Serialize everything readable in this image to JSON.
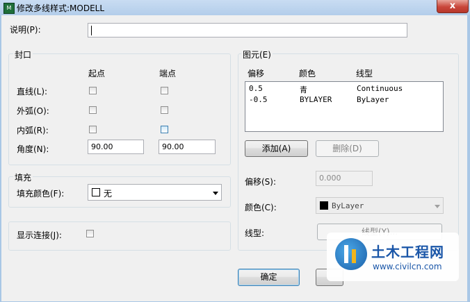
{
  "window": {
    "title": "修改多线样式:MODELL",
    "app_icon": "M",
    "close_glyph": "x"
  },
  "description": {
    "label": "说明(P):",
    "value": ""
  },
  "caps": {
    "group_title": "封口",
    "col_start": "起点",
    "col_end": "端点",
    "rows": [
      {
        "label": "直线(L):"
      },
      {
        "label": "外弧(O):"
      },
      {
        "label": "内弧(R):"
      }
    ],
    "angle_label": "角度(N):",
    "angle_start": "90.00",
    "angle_end": "90.00"
  },
  "fill": {
    "group_title": "填充",
    "color_label": "填充颜色(F):",
    "color_value": "无"
  },
  "joints": {
    "label": "显示连接(J):"
  },
  "elements": {
    "group_title": "图元(E)",
    "columns": [
      "偏移",
      "颜色",
      "线型"
    ],
    "rows": [
      {
        "offset": "0.5",
        "color": "青",
        "linetype": "Continuous"
      },
      {
        "offset": "-0.5",
        "color": "BYLAYER",
        "linetype": "ByLayer"
      }
    ],
    "add_button": "添加(A)",
    "delete_button": "删除(D)",
    "offset_label": "偏移(S):",
    "offset_value": "0.000",
    "color_label": "颜色(C):",
    "color_value": "ByLayer",
    "linetype_label": "线型:",
    "linetype_button": "线型(Y)..."
  },
  "footer": {
    "ok_button": "确定"
  },
  "watermark": {
    "title": "土木工程网",
    "url": "www.civilcn.com"
  },
  "colors": {
    "accent": "#3c7fb1",
    "close": "#c9463a",
    "swatch_black": "#000000",
    "swatch_none": "#ffffff"
  }
}
